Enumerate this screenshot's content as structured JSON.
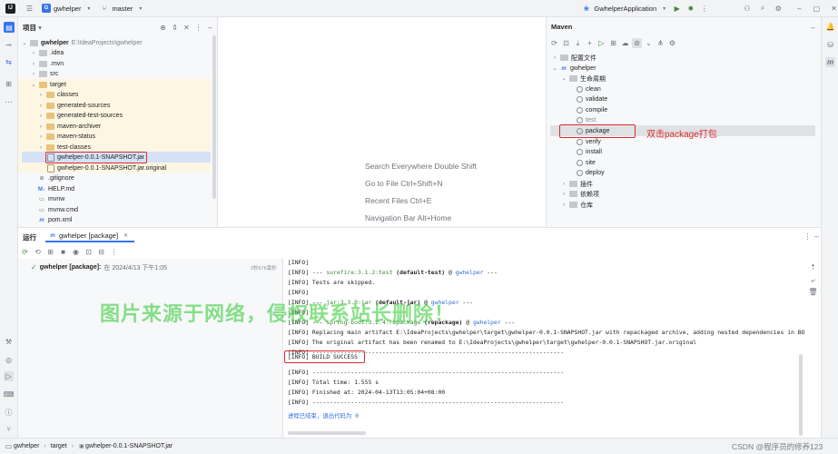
{
  "titlebar": {
    "project_badge": "G",
    "project_name": "gwhelper",
    "branch": "master",
    "run_config": "GwhelperApplication"
  },
  "project_panel": {
    "title": "项目",
    "root_name": "gwhelper",
    "root_path": "E:\\IdeaProjects\\gwhelper",
    "items": [
      {
        "label": ".idea"
      },
      {
        "label": ".mvn"
      },
      {
        "label": "src"
      },
      {
        "label": "target"
      },
      {
        "label": "classes"
      },
      {
        "label": "generated-sources"
      },
      {
        "label": "generated-test-sources"
      },
      {
        "label": "maven-archiver"
      },
      {
        "label": "maven-status"
      },
      {
        "label": "test-classes"
      },
      {
        "label": "gwhelper-0.0.1-SNAPSHOT.jar"
      },
      {
        "label": "gwhelper-0.0.1-SNAPSHOT.jar.original"
      },
      {
        "label": ".gitignore"
      },
      {
        "label": "HELP.md"
      },
      {
        "label": "mvnw"
      },
      {
        "label": "mvnw.cmd"
      },
      {
        "label": "pom.xml"
      }
    ]
  },
  "editor_hints": [
    "Search Everywhere Double Shift",
    "Go to File Ctrl+Shift+N",
    "Recent Files Ctrl+E",
    "Navigation Bar Alt+Home"
  ],
  "maven": {
    "title": "Maven",
    "items": [
      {
        "label": "配置文件"
      },
      {
        "label": "gwhelper"
      },
      {
        "label": "生命周期"
      },
      {
        "label": "clean"
      },
      {
        "label": "validate"
      },
      {
        "label": "compile"
      },
      {
        "label": "test"
      },
      {
        "label": "package"
      },
      {
        "label": "verify"
      },
      {
        "label": "install"
      },
      {
        "label": "site"
      },
      {
        "label": "deploy"
      },
      {
        "label": "插件"
      },
      {
        "label": "依赖项"
      },
      {
        "label": "仓库"
      }
    ],
    "annotation": "双击package打包"
  },
  "run_panel": {
    "tab_label": "运行",
    "config_tab": "gwhelper [package]",
    "tree_item": "gwhelper [package]:",
    "tree_item_time": "在 2024/4/13 下午1:05",
    "tree_item_duration": "2秒676毫秒"
  },
  "console": {
    "lines": [
      {
        "a": "[INFO]",
        "b": ""
      },
      {
        "a": "[INFO] --- ",
        "g": "surefire:3.1.2:test",
        "k": " (default-test)",
        "c": " @ ",
        "u": "gwhelper",
        "e": " ---"
      },
      {
        "a": "[INFO] Tests are skipped.",
        "b": ""
      },
      {
        "a": "[INFO]",
        "b": ""
      },
      {
        "a": "[INFO] --- ",
        "g": "jar:3.3.0:jar",
        "k": " (default-jar)",
        "c": " @ ",
        "u": "gwhelper",
        "e": " ---"
      },
      {
        "a": "[INFO]",
        "b": ""
      },
      {
        "a": "[INFO] --- ",
        "g": "spring-boot:3.2.4:repackage",
        "k": " (repackage)",
        "c": " @ ",
        "u": "gwhelper",
        "e": " ---"
      },
      {
        "a": "[INFO] Replacing main artifact E:\\IdeaProjects\\gwhelper\\target\\gwhelper-0.0.1-SNAPSHOT.jar with repackaged archive, adding nested dependencies in BO",
        "b": ""
      },
      {
        "a": "[INFO] The original artifact has been renamed to E:\\IdeaProjects\\gwhelper\\target\\gwhelper-0.0.1-SNAPSHOT.jar.original",
        "b": ""
      },
      {
        "a": "[INFO] ------------------------------------------------------------------------",
        "b": ""
      },
      {
        "a": "[INFO] BUILD SUCCESS",
        "b": ""
      },
      {
        "a": "[INFO] ------------------------------------------------------------------------",
        "b": ""
      },
      {
        "a": "[INFO] Total time:  1.555 s",
        "b": ""
      },
      {
        "a": "[INFO] Finished at: 2024-04-13T13:05:04+08:00",
        "b": ""
      },
      {
        "a": "[INFO] ------------------------------------------------------------------------",
        "b": ""
      }
    ],
    "exit_line": "进程已结束，退出代码为 0"
  },
  "statusbar": {
    "crumbs": [
      "gwhelper",
      "target",
      "gwhelper-0.0.1-SNAPSHOT.jar"
    ]
  },
  "watermark": "图片来源于网络，侵权联系站长删除！",
  "credit": "CSDN @程序员的修养123",
  "colors": {
    "accent": "#3574f0",
    "annotation_red": "#d92b2b",
    "watermark_green": "#28c828"
  }
}
